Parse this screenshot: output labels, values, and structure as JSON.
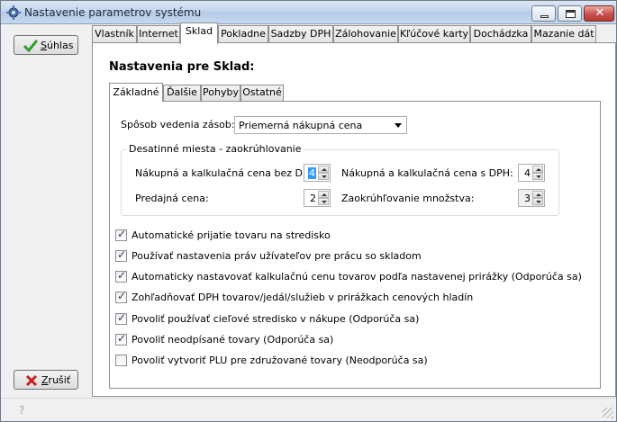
{
  "window": {
    "title": "Nastavenie parametrov systému"
  },
  "buttons": {
    "confirm_label": "Súhlas",
    "confirm_hotkey": "S",
    "confirm_rest": "úhlas",
    "cancel_label": "Zrušiť",
    "cancel_hotkey": "Z",
    "cancel_rest": "rušiť"
  },
  "tabs": [
    {
      "label": "Vlastník"
    },
    {
      "label": "Internet"
    },
    {
      "label": "Sklad"
    },
    {
      "label": "Pokladne"
    },
    {
      "label": "Sadzby DPH"
    },
    {
      "label": "Zálohovanie"
    },
    {
      "label": "Kľúčové karty"
    },
    {
      "label": "Dochádzka"
    },
    {
      "label": "Mazanie dát"
    }
  ],
  "active_tab": "Sklad",
  "section_title": "Nastavenia pre Sklad:",
  "subtabs": [
    {
      "label": "Základné"
    },
    {
      "label": "Ďalšie"
    },
    {
      "label": "Pohyby"
    },
    {
      "label": "Ostatné"
    }
  ],
  "active_subtab": "Základné",
  "stock_method": {
    "label": "Spôsob vedenia zásob:",
    "value": "Priemerná nákupná cena"
  },
  "decimals_group": {
    "legend": "Desatinné miesta - zaokrúhlovanie",
    "purchase_net_label": "Nákupná a kalkulačná cena bez DPH:",
    "purchase_net_value": "4",
    "purchase_gross_label": "Nákupná a kalkulačná cena s DPH:",
    "purchase_gross_value": "4",
    "sale_label": "Predajná cena:",
    "sale_value": "2",
    "quantity_label": "Zaokrúhľovanie množstva:",
    "quantity_value": "3"
  },
  "options": [
    {
      "label": "Automatické prijatie tovaru na stredisko",
      "checked": true
    },
    {
      "label": "Používať nastavenia práv užívateľov pre prácu so skladom",
      "checked": true
    },
    {
      "label": "Automaticky nastavovať kalkulačnú cenu tovarov podľa nastavenej prirážky (Odporúča sa)",
      "checked": true
    },
    {
      "label": "Zohľadňovať DPH tovarov/jedál/služieb v prirážkach cenových hladín",
      "checked": true
    },
    {
      "label": "Povoliť používať cieľové stredisko v nákupe (Odporúča sa)",
      "checked": true
    },
    {
      "label": "Povoliť neodpísané tovary (Odporúča sa)",
      "checked": true
    },
    {
      "label": "Povoliť vytvoriť PLU pre združované tovary (Neodporúča sa)",
      "checked": false
    }
  ],
  "icons": {
    "window": "gear-icon",
    "confirm": "checkmark-icon",
    "cancel": "x-icon",
    "help": "help-icon"
  },
  "colors": {
    "confirm_icon": "#2e9e2e",
    "cancel_icon": "#c82020",
    "selection": "#3399ff"
  }
}
